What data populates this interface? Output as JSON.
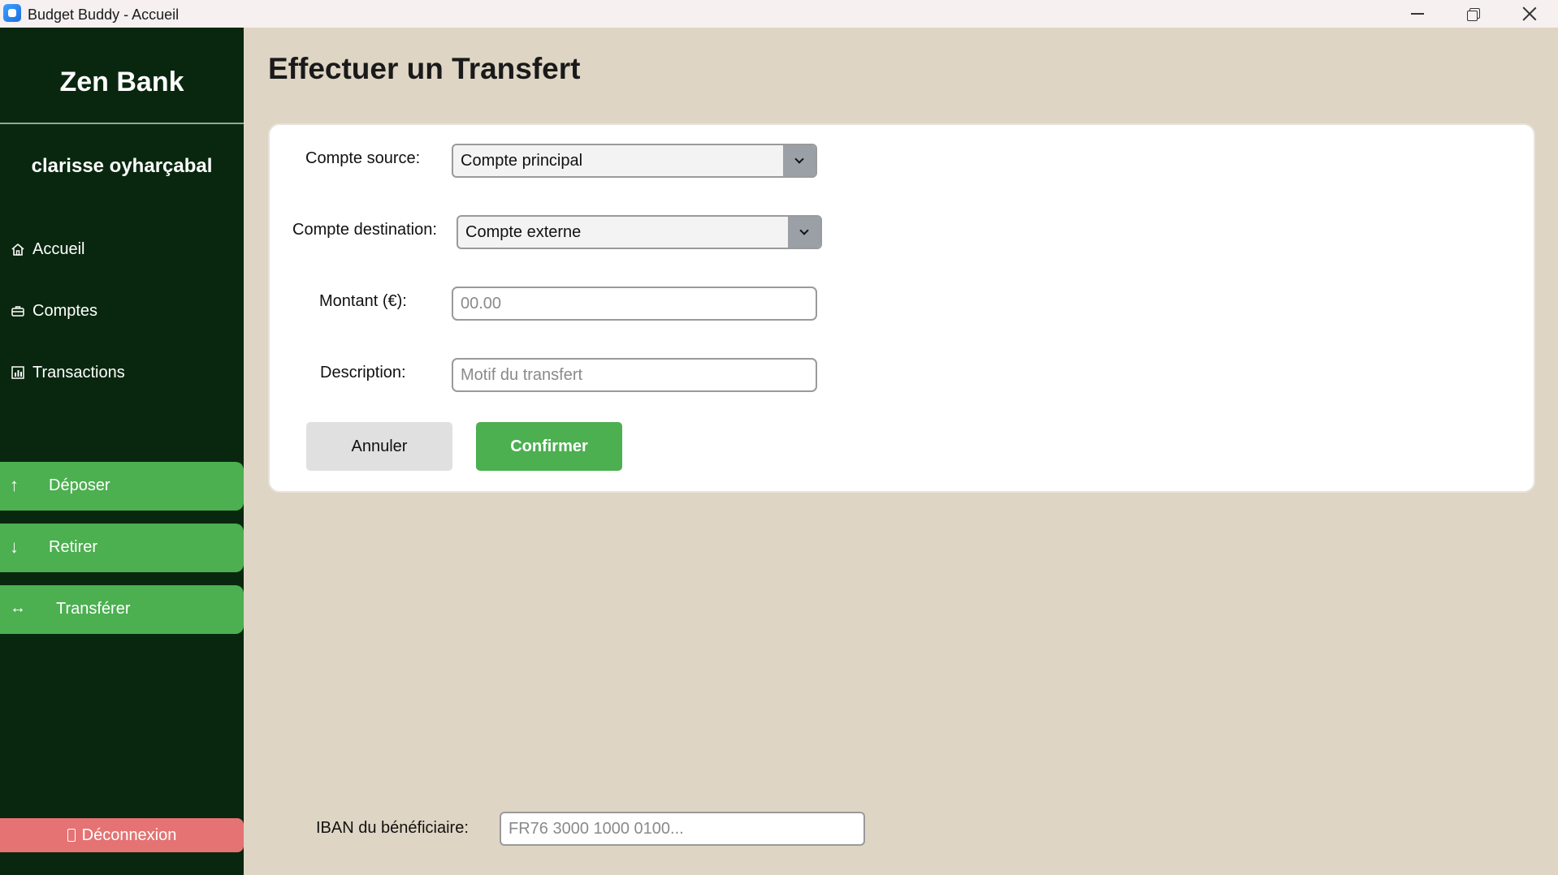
{
  "window": {
    "title": "Budget Buddy - Accueil"
  },
  "sidebar": {
    "brand": "Zen Bank",
    "username": "clarisse oyharçabal",
    "nav": [
      {
        "label": "Accueil",
        "icon": "home-icon"
      },
      {
        "label": "Comptes",
        "icon": "briefcase-icon"
      },
      {
        "label": "Transactions",
        "icon": "bar-chart-icon"
      }
    ],
    "actions": [
      {
        "label": "Déposer",
        "icon": "↑"
      },
      {
        "label": "Retirer",
        "icon": "↓"
      },
      {
        "label": "Transférer",
        "icon": "↔"
      }
    ],
    "logout": "Déconnexion"
  },
  "page": {
    "title": "Effectuer un Transfert"
  },
  "form": {
    "source_label": "Compte source:",
    "source_value": "Compte principal",
    "destination_label": "Compte destination:",
    "destination_value": "Compte externe",
    "amount_label": "Montant (€):",
    "amount_placeholder": "00.00",
    "description_label": "Description:",
    "description_placeholder": "Motif du transfert",
    "cancel_label": "Annuler",
    "confirm_label": "Confirmer",
    "iban_label": "IBAN du bénéficiaire:",
    "iban_placeholder": "FR76 3000 1000 0100..."
  },
  "colors": {
    "sidebar_bg": "#09270f",
    "accent_green": "#4caf50",
    "logout_red": "#e57373",
    "page_bg": "#dfd5c4"
  }
}
